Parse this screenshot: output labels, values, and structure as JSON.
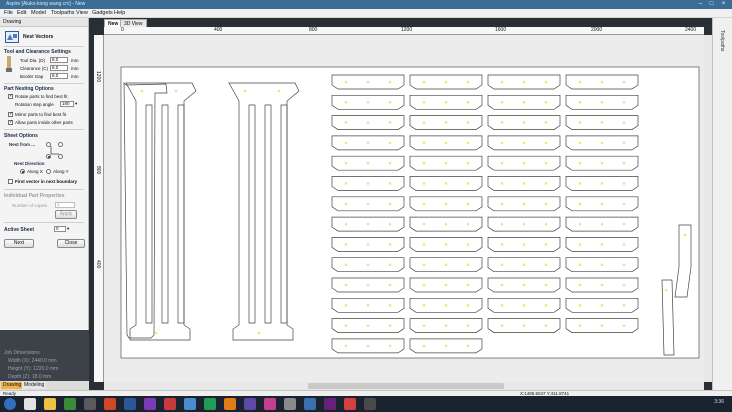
{
  "titlebar": {
    "title": "Aspire [Aluko-kong wang.crv] - New"
  },
  "menu": [
    "File",
    "Edit",
    "Model",
    "Toolpaths",
    "View",
    "Gadgets",
    "Help"
  ],
  "left_panel": {
    "header": "Drawing",
    "title": "Nest Vectors",
    "tool_section": "Tool and Clearance Settings",
    "tool_dia_label": "Tool Dia. (D)",
    "tool_dia_value": "8.0",
    "clearance_label": "Clearance (C)",
    "clearance_value": "8.0",
    "border_gap_label": "Border Gap",
    "border_gap_value": "8.0",
    "unit": "mm",
    "part_section": "Part Nesting Options",
    "rotate_label": "Rotate parts to find best fit",
    "rotation_step_label": "Rotation step angle",
    "rotation_step_value": "180",
    "mirror_label": "Mirror parts to find best fit",
    "allow_label": "Allow parts inside other parts",
    "sheet_section": "Sheet Options",
    "nest_from_label": "Nest from ...",
    "nest_direction_label": "Nest Direction",
    "along_x_label": "Along X",
    "along_y_label": "Along Y",
    "first_vector_label": "First vector in next boundary",
    "individual_section": "Individual Part Properties",
    "num_copies_label": "Number of copies",
    "num_copies_value": "1",
    "apply_label": "Apply",
    "active_sheet_label": "Active Sheet",
    "active_sheet_value": "0",
    "next_label": "Next",
    "close_label": "Close"
  },
  "job_dims": {
    "title": "Job Dimensions",
    "width": "Width  (X): 2440.0 mm",
    "height": "Height (Y): 1220.0 mm",
    "depth": "Depth  (Z): 18.0 mm"
  },
  "bottom_tabs": [
    "Drawing",
    "Modeling"
  ],
  "doc_tabs": [
    "New",
    "3D View"
  ],
  "ruler_top": [
    "0",
    "400",
    "800",
    "1200",
    "1600",
    "2000",
    "2400"
  ],
  "ruler_left": [
    "1200",
    "800",
    "400"
  ],
  "right_panel": "Toolpaths",
  "status": {
    "left": "Ready",
    "coords": "X:1485.5047 Y:411.8741"
  },
  "clock": "3:36"
}
